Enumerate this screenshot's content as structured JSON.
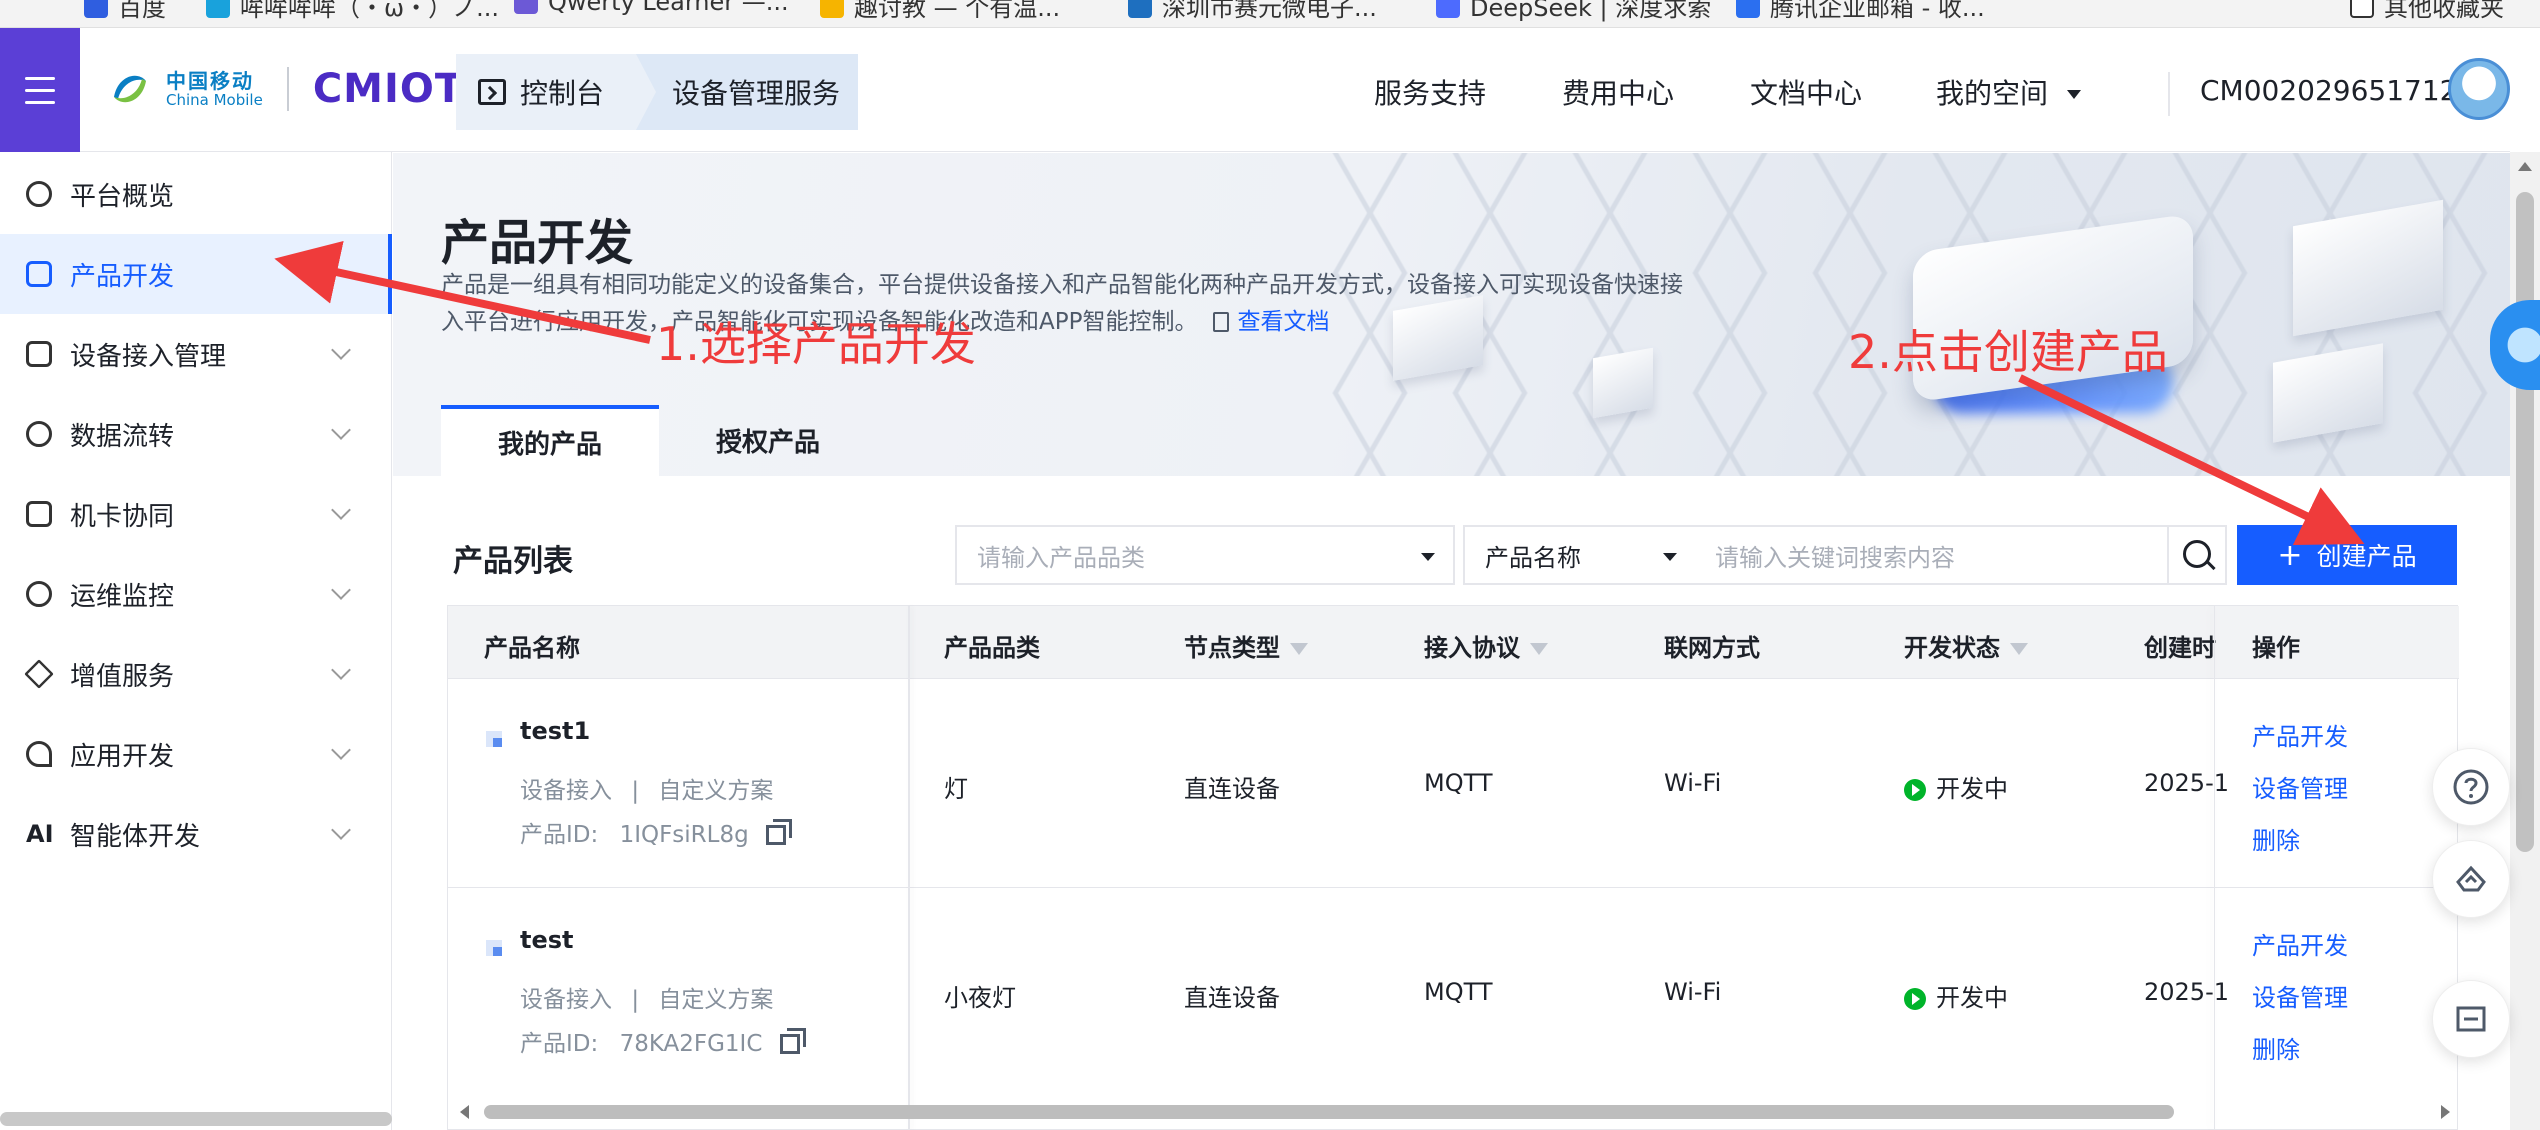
{
  "bookmarks": [
    {
      "label": "百度"
    },
    {
      "label": "哞哞哞哞（・ω・）ノ..."
    },
    {
      "label": "Qwerty Learner —..."
    },
    {
      "label": "趣讨教 — 个有温..."
    },
    {
      "label": "深圳市赛元微电子..."
    },
    {
      "label": "DeepSeek | 深度求索"
    },
    {
      "label": "腾讯企业邮箱 - 收..."
    },
    {
      "label": "其他收藏夹"
    }
  ],
  "header": {
    "logo_cn": "中国移动",
    "logo_en": "China Mobile",
    "brand": "CMIOT",
    "breadcrumb": [
      "控制台",
      "设备管理服务"
    ],
    "nav": [
      "服务支持",
      "费用中心",
      "文档中心",
      "我的空间"
    ],
    "account": "CM002029651712"
  },
  "sidebar": {
    "items": [
      {
        "label": "平台概览",
        "icon": "platform-icon"
      },
      {
        "label": "产品开发",
        "icon": "product-cube-icon"
      },
      {
        "label": "设备接入管理",
        "icon": "device-access-icon"
      },
      {
        "label": "数据流转",
        "icon": "data-flow-icon"
      },
      {
        "label": "机卡协同",
        "icon": "card-sync-icon"
      },
      {
        "label": "运维监控",
        "icon": "monitor-icon"
      },
      {
        "label": "增值服务",
        "icon": "value-added-icon"
      },
      {
        "label": "应用开发",
        "icon": "app-dev-icon"
      },
      {
        "label": "智能体开发",
        "icon": "ai-icon"
      }
    ],
    "ai_glyph": "AI"
  },
  "page": {
    "title": "产品开发",
    "description": "产品是一组具有相同功能定义的设备集合，平台提供设备接入和产品智能化两种产品开发方式，设备接入可实现设备快速接入平台进行应用开发，产品智能化可实现设备智能化改造和APP智能控制。",
    "doc_link": "查看文档",
    "tabs": [
      "我的产品",
      "授权产品"
    ]
  },
  "toolbar": {
    "list_title": "产品列表",
    "category_placeholder": "请输入产品品类",
    "field_select": "产品名称",
    "keyword_placeholder": "请输入关键词搜索内容",
    "create_label": "创建产品",
    "create_plus": "+"
  },
  "table": {
    "columns": [
      "产品名称",
      "产品品类",
      "节点类型",
      "接入协议",
      "联网方式",
      "开发状态",
      "创建时",
      "操作"
    ],
    "rows": [
      {
        "name": "test1",
        "access": "设备接入",
        "sep": "|",
        "scheme": "自定义方案",
        "id_label": "产品ID:",
        "id": "1IQFsiRL8g",
        "category": "灯",
        "node": "直连设备",
        "protocol": "MQTT",
        "network": "Wi-Fi",
        "status": "开发中",
        "created": "2025-1",
        "ops": [
          "产品开发",
          "设备管理",
          "删除"
        ]
      },
      {
        "name": "test",
        "access": "设备接入",
        "sep": "|",
        "scheme": "自定义方案",
        "id_label": "产品ID:",
        "id": "78KA2FG1IC",
        "category": "小夜灯",
        "node": "直连设备",
        "protocol": "MQTT",
        "network": "Wi-Fi",
        "status": "开发中",
        "created": "2025-1",
        "ops": [
          "产品开发",
          "设备管理",
          "删除"
        ]
      }
    ]
  },
  "annotations": [
    {
      "text": "1.选择产品开发",
      "color": "#ef3b3b"
    },
    {
      "text": "2.点击创建产品",
      "color": "#ef3b3b"
    }
  ],
  "colors": {
    "accent": "#165dff",
    "menu": "#5b3fd6",
    "status_ok": "#00b42a",
    "annotation": "#ef3b3b"
  }
}
